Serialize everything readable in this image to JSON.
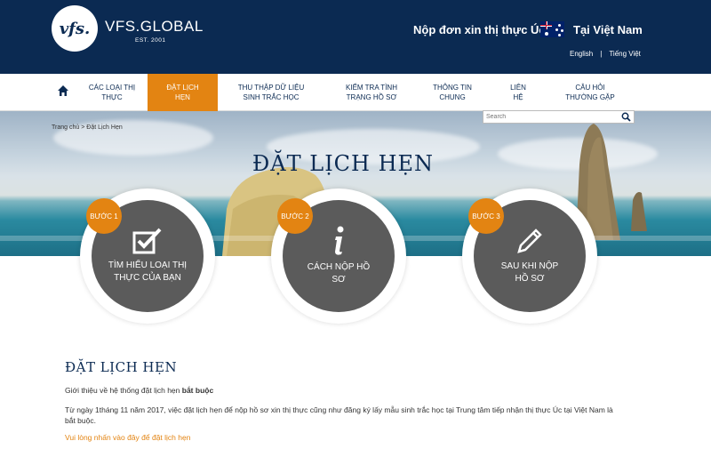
{
  "header": {
    "logo_text": "vfs.",
    "brand": "VFS.GLOBAL",
    "est": "EST. 2001",
    "apply_title": "Nộp đơn xin thị thực Úc",
    "location": "Tại Việt Nam",
    "languages": [
      "English",
      "Tiếng Việt"
    ],
    "flag_icon": "australia-flag-icon"
  },
  "nav": {
    "home_icon": "home-icon",
    "items": [
      {
        "label": "CÁC LOẠI THỊ THỰC"
      },
      {
        "label": "ĐẶT LỊCH HẸN"
      },
      {
        "label": "THU THẬP DỮ LIỆU SINH TRẮC HỌC"
      },
      {
        "label": "KIỂM TRA TÌNH TRẠNG HỒ SƠ"
      },
      {
        "label": "THÔNG TIN CHUNG"
      },
      {
        "label": "LIÊN HỆ"
      },
      {
        "label": "CÂU HỎI THƯỜNG GẶP"
      }
    ],
    "active_color": "#e38412"
  },
  "search": {
    "placeholder": "Search",
    "icon": "search-icon"
  },
  "breadcrumb": {
    "home": "Trang chủ",
    "separator": ">",
    "current": "Đặt Lịch Hẹn"
  },
  "hero": {
    "title": "ĐẶT LỊCH HẸN"
  },
  "steps": [
    {
      "badge": "BƯỚC 1",
      "label": "TÌM HIỂU LOẠI THỊ THỰC CỦA BẠN",
      "icon": "checkbox-icon"
    },
    {
      "badge": "BƯỚC 2",
      "label": "CÁCH NỘP HỒ SƠ",
      "icon": "info-icon"
    },
    {
      "badge": "BƯỚC 3",
      "label": "SAU KHI NỘP HỒ SƠ",
      "icon": "pencil-icon"
    }
  ],
  "content": {
    "title": "ĐẶT LỊCH HẸN",
    "intro_prefix": "Giới thiệu về hệ thống đặt lịch hẹn",
    "intro_bold": "bắt buộc",
    "paragraph": "Từ ngày 1tháng 11 năm 2017, việc đặt lịch hẹn để nộp hồ sơ xin thị thực cũng như đăng ký lấy mẫu sinh trắc học tại Trung tâm tiếp nhận thị thực Úc tại Việt Nam là bắt buộc.",
    "link": "Vui lòng nhấn vào đây để đặt lịch hẹn"
  },
  "colors": {
    "navy": "#0b2a52",
    "orange": "#e38412",
    "step_gray": "#5b5b5b"
  }
}
